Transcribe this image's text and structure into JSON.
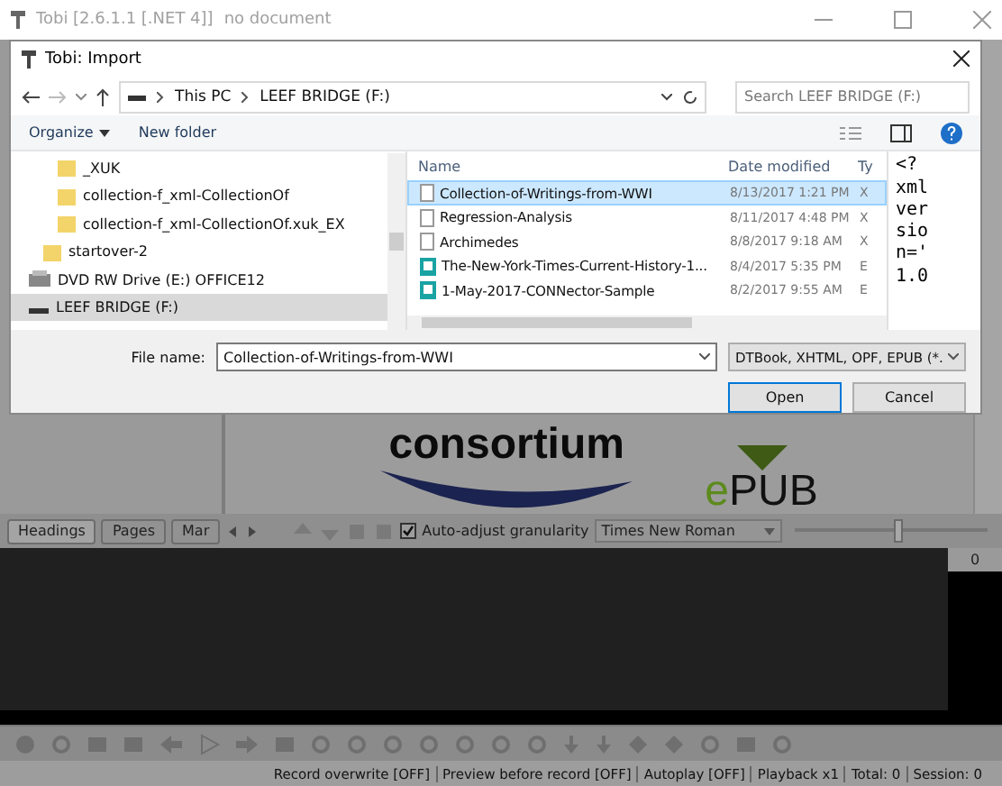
{
  "window": {
    "title": "Tobi [2.6.1.1 [.NET 4]]",
    "subtitle": "no document"
  },
  "dialog": {
    "title": "Tobi: Import",
    "address": {
      "crumbs": [
        "This PC",
        "LEEF BRIDGE (F:)"
      ]
    },
    "search": {
      "placeholder": "Search LEEF BRIDGE (F:)"
    },
    "toolbar": {
      "organize": "Organize",
      "new_folder": "New folder"
    },
    "nav_tree": [
      {
        "kind": "continued",
        "children": [
          {
            "kind": "continued",
            "children": [
              {
                "kind": "folder",
                "label": "_XUK",
                "selected": false
              },
              {
                "kind": "folder",
                "label": "collection-f_xml-CollectionOf",
                "selected": false
              },
              {
                "kind": "folder",
                "label": "collection-f_xml-CollectionOf.xuk_EX",
                "selected": false
              }
            ]
          },
          {
            "kind": "folder",
            "label": "startover-2",
            "selected": false
          }
        ]
      },
      {
        "kind": "dvd",
        "label": "DVD RW Drive (E:) OFFICE12",
        "selected": false
      },
      {
        "kind": "drive",
        "label": "LEEF BRIDGE (F:)",
        "selected": true
      }
    ],
    "columns": [
      "Name",
      "Date modified",
      "Ty"
    ],
    "files": [
      {
        "kind": "document",
        "name": "Collection-of-Writings-from-WWI",
        "date": "8/13/2017 1:21 PM",
        "type": "X",
        "selected": true
      },
      {
        "kind": "document",
        "name": "Regression-Analysis",
        "date": "8/11/2017 4:48 PM",
        "type": "X",
        "selected": false
      },
      {
        "kind": "document",
        "name": "Archimedes",
        "date": "8/8/2017 9:18 AM",
        "type": "X",
        "selected": false
      },
      {
        "kind": "epub",
        "name": "The-New-York-Times-Current-History-1...",
        "date": "8/4/2017 5:35 PM",
        "type": "E",
        "selected": false
      },
      {
        "kind": "epub",
        "name": "1-May-2017-CONNector-Sample",
        "date": "8/2/2017 9:55 AM",
        "type": "E",
        "selected": false
      }
    ],
    "preview": {
      "lines": [
        "<?",
        "xml",
        "ver",
        "sio",
        "n='",
        "1.0"
      ]
    },
    "file_name": {
      "label": "File name:",
      "value": "Collection-of-Writings-from-WWI"
    },
    "file_type": "DTBook, XHTML, OPF, EPUB (*.",
    "buttons": [
      "Open",
      "Cancel"
    ]
  },
  "document": {
    "logo_word": "consortium",
    "epub_prefix": "e",
    "epub_rest": "PUB"
  },
  "nav_tabs": [
    {
      "label": "Headings",
      "selected": true
    },
    {
      "label": "Pages",
      "selected": false
    },
    {
      "label": "Mar",
      "selected": false
    }
  ],
  "granularity": {
    "label": "Auto-adjust granularity",
    "checked": true
  },
  "font": "Times New Roman",
  "zoom": {
    "level": 0.53
  },
  "counter": "0",
  "status_bar": [
    "Record overwrite [OFF]",
    "Preview before record [OFF]",
    "Autoplay [OFF]",
    "Playback x1",
    "Total: 0",
    "Session: 0"
  ]
}
